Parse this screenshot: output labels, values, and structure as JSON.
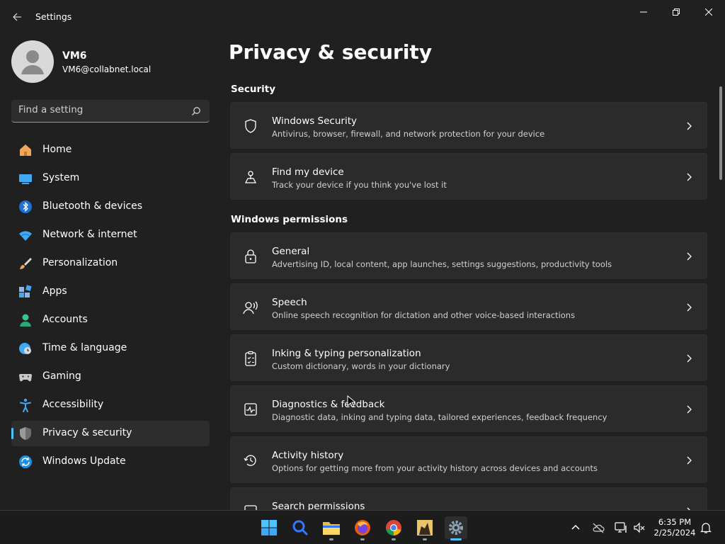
{
  "window": {
    "title": "Settings"
  },
  "user": {
    "name": "VM6",
    "email": "VM6@collabnet.local"
  },
  "search": {
    "placeholder": "Find a setting"
  },
  "sidebar": {
    "items": [
      {
        "label": "Home",
        "icon": "home-icon"
      },
      {
        "label": "System",
        "icon": "system-icon"
      },
      {
        "label": "Bluetooth & devices",
        "icon": "bluetooth-icon"
      },
      {
        "label": "Network & internet",
        "icon": "wifi-icon"
      },
      {
        "label": "Personalization",
        "icon": "brush-icon"
      },
      {
        "label": "Apps",
        "icon": "apps-icon"
      },
      {
        "label": "Accounts",
        "icon": "accounts-icon"
      },
      {
        "label": "Time & language",
        "icon": "clock-globe-icon"
      },
      {
        "label": "Gaming",
        "icon": "gamepad-icon"
      },
      {
        "label": "Accessibility",
        "icon": "accessibility-icon"
      },
      {
        "label": "Privacy & security",
        "icon": "shield-icon",
        "selected": true
      },
      {
        "label": "Windows Update",
        "icon": "update-icon"
      }
    ]
  },
  "main": {
    "title": "Privacy & security",
    "sections": [
      {
        "heading": "Security",
        "cards": [
          {
            "title": "Windows Security",
            "desc": "Antivirus, browser, firewall, and network protection for your device",
            "icon": "shield-outline-icon"
          },
          {
            "title": "Find my device",
            "desc": "Track your device if you think you've lost it",
            "icon": "find-device-icon"
          }
        ]
      },
      {
        "heading": "Windows permissions",
        "cards": [
          {
            "title": "General",
            "desc": "Advertising ID, local content, app launches, settings suggestions, productivity tools",
            "icon": "lock-icon"
          },
          {
            "title": "Speech",
            "desc": "Online speech recognition for dictation and other voice-based interactions",
            "icon": "speech-icon"
          },
          {
            "title": "Inking & typing personalization",
            "desc": "Custom dictionary, words in your dictionary",
            "icon": "clipboard-icon"
          },
          {
            "title": "Diagnostics & feedback",
            "desc": "Diagnostic data, inking and typing data, tailored experiences, feedback frequency",
            "icon": "diagnostics-icon"
          },
          {
            "title": "Activity history",
            "desc": "Options for getting more from your activity history across devices and accounts",
            "icon": "history-icon"
          },
          {
            "title": "Search permissions",
            "desc": "",
            "icon": "search-permissions-icon"
          }
        ]
      }
    ]
  },
  "taskbar": {
    "apps": [
      "start-icon",
      "search-icon",
      "file-explorer-icon",
      "firefox-icon",
      "chrome-icon",
      "app-icon",
      "settings-icon"
    ],
    "time": "6:35 PM",
    "date": "2/25/2024"
  },
  "colors": {
    "background": "#202020",
    "card": "#2b2b2b",
    "accent": "#4cc2ff"
  }
}
